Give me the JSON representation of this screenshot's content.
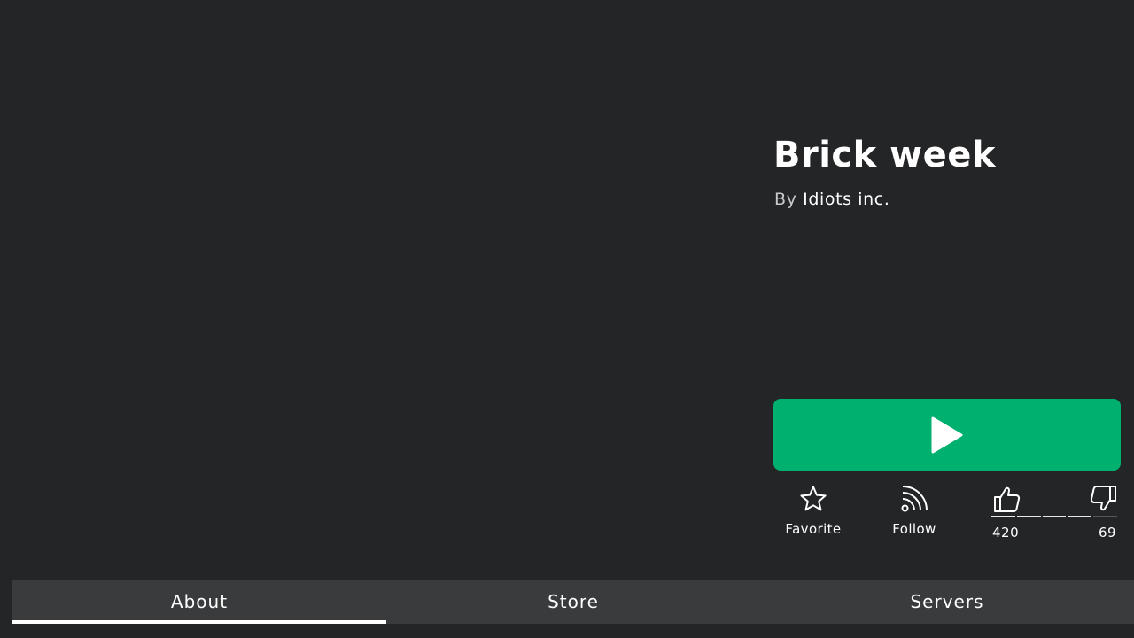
{
  "game": {
    "title": "Brick week",
    "creator_prefix": "By",
    "creator_name": "Idiots inc."
  },
  "play_button": {
    "icon": "play-icon",
    "color": "#00b06f"
  },
  "actions": {
    "favorite": {
      "label": "Favorite",
      "icon": "star-icon"
    },
    "follow": {
      "label": "Follow",
      "icon": "rss-icon"
    }
  },
  "votes": {
    "up_count": "420",
    "down_count": "69",
    "up_icon": "thumbs-up-icon",
    "down_icon": "thumbs-down-icon"
  },
  "tabs": [
    {
      "label": "About",
      "active": true
    },
    {
      "label": "Store",
      "active": false
    },
    {
      "label": "Servers",
      "active": false
    }
  ],
  "colors": {
    "background": "#232527",
    "tab_bar": "#393b3d",
    "accent_green": "#00b06f"
  }
}
